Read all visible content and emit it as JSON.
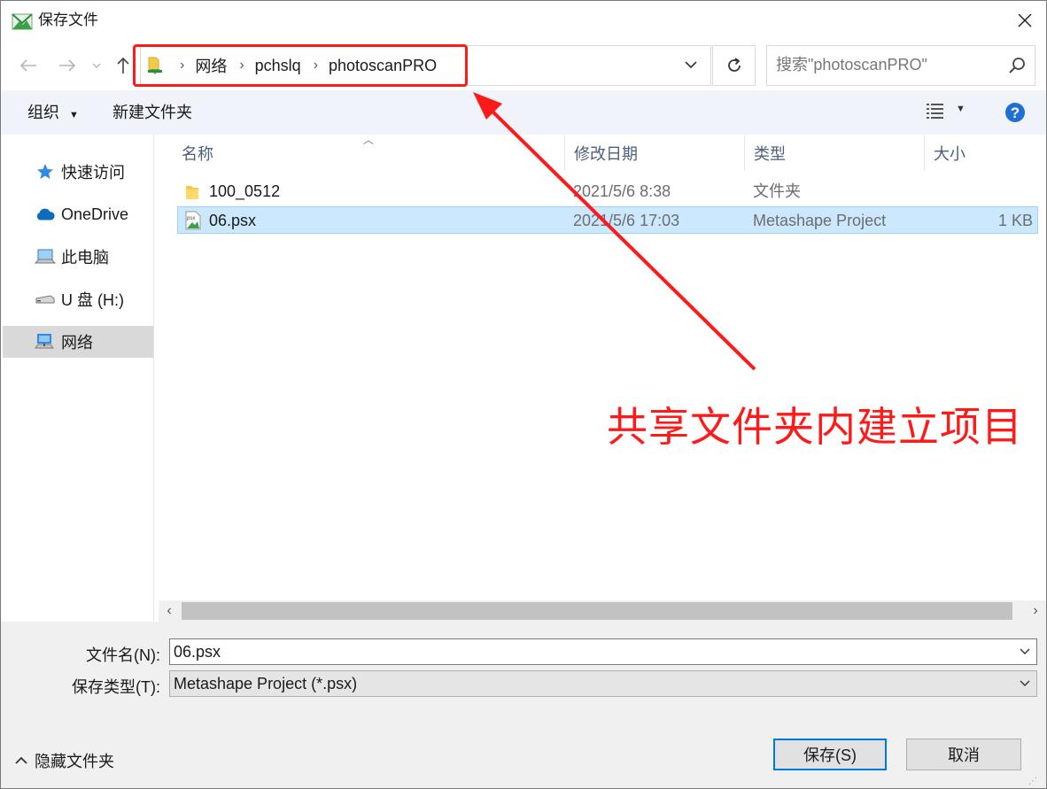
{
  "window": {
    "title": "保存文件"
  },
  "address": {
    "crumbs": [
      "网络",
      "pchslq",
      "photoscanPRO"
    ]
  },
  "search": {
    "placeholder": "搜索\"photoscanPRO\""
  },
  "toolbar": {
    "organize": "组织",
    "new_folder": "新建文件夹"
  },
  "sidebar": {
    "items": [
      {
        "label": "快速访问",
        "icon": "star-icon"
      },
      {
        "label": "OneDrive",
        "icon": "cloud-icon"
      },
      {
        "label": "此电脑",
        "icon": "computer-icon"
      },
      {
        "label": "U 盘 (H:)",
        "icon": "usb-drive-icon"
      },
      {
        "label": "网络",
        "icon": "network-icon",
        "selected": true
      }
    ]
  },
  "list": {
    "columns": [
      "名称",
      "修改日期",
      "类型",
      "大小"
    ],
    "rows": [
      {
        "name": "100_0512",
        "date": "2021/5/6 8:38",
        "type": "文件夹",
        "size": "",
        "icon": "folder-icon"
      },
      {
        "name": "06.psx",
        "date": "2021/5/6 17:03",
        "type": "Metashape Project",
        "size": "1 KB",
        "icon": "psx-file-icon",
        "selected": true
      }
    ]
  },
  "form": {
    "filename_label": "文件名(N):",
    "filename_value": "06.psx",
    "filetype_label": "保存类型(T):",
    "filetype_value": "Metashape Project (*.psx)"
  },
  "footer": {
    "hide_folders": "隐藏文件夹",
    "save": "保存(S)",
    "cancel": "取消"
  },
  "annotation": {
    "text": "共享文件夹内建立项目",
    "color": "#ff1a1a"
  },
  "colors": {
    "accent": "#0078d7",
    "selection": "#cce8ff"
  }
}
